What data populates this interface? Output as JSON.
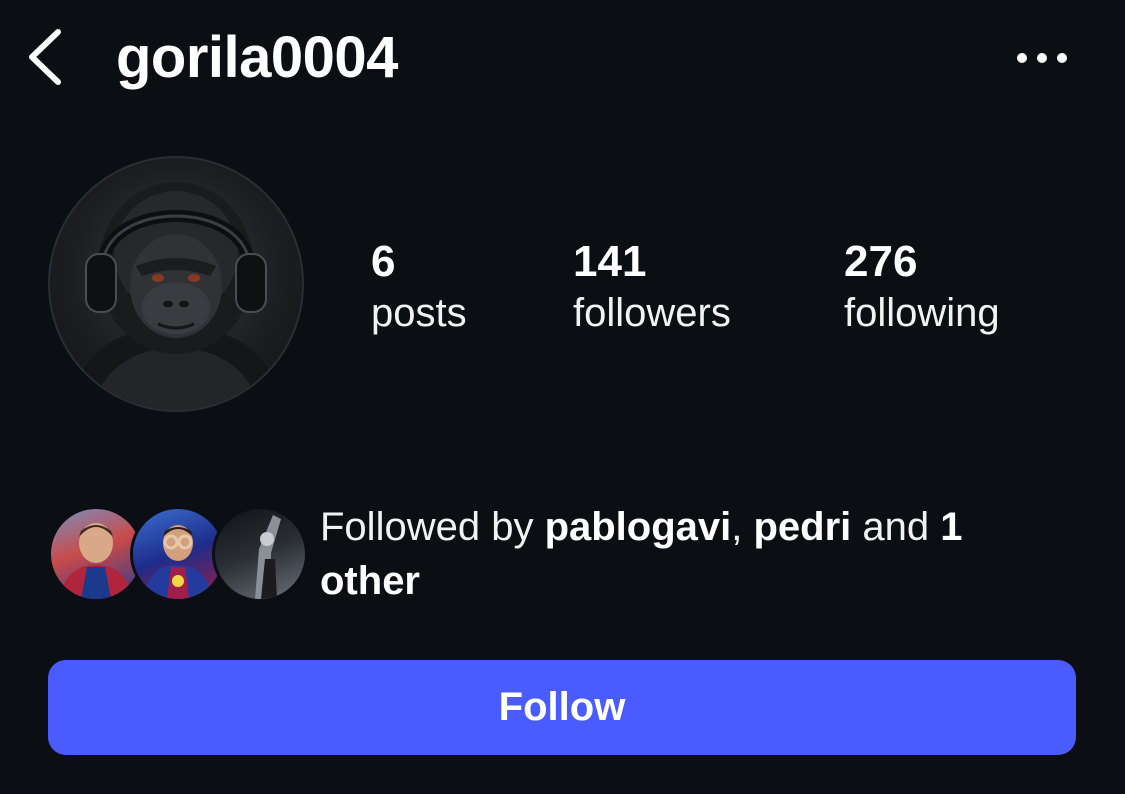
{
  "header": {
    "username": "gorila0004",
    "back_icon": "chevron-left-icon",
    "more_icon": "more-horizontal-icon"
  },
  "profile": {
    "avatar": "gorilla-with-headphones-avatar"
  },
  "stats": {
    "posts": {
      "count": "6",
      "label": "posts"
    },
    "followers": {
      "count": "141",
      "label": "followers"
    },
    "following": {
      "count": "276",
      "label": "following"
    }
  },
  "mutual": {
    "prefix": "Followed by ",
    "user1": "pablogavi",
    "separator": ", ",
    "user2": "pedri",
    "conjunction": " and ",
    "others": "1 other"
  },
  "actions": {
    "follow_label": "Follow"
  },
  "colors": {
    "background": "#0b0f14",
    "follow_button": "#4a5cff",
    "text": "#ffffff"
  }
}
